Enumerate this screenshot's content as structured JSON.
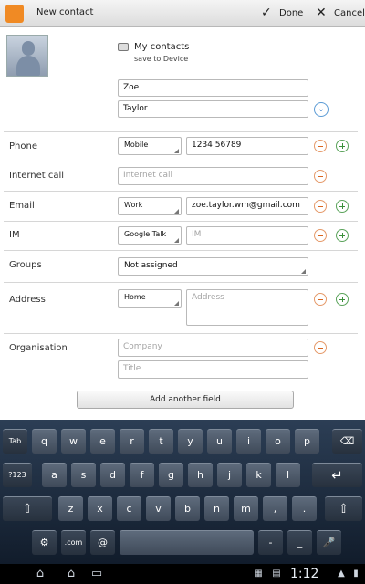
{
  "header": {
    "title": "New contact",
    "done_label": "Done",
    "cancel_label": "Cancel"
  },
  "account": {
    "name": "My contacts",
    "sub": "save to Device"
  },
  "name": {
    "first": "Zoe",
    "last": "Taylor"
  },
  "phone": {
    "label": "Phone",
    "type": "Mobile",
    "value": "1234 56789"
  },
  "internet_call": {
    "label": "Internet call",
    "placeholder": "Internet call"
  },
  "email": {
    "label": "Email",
    "type": "Work",
    "value": "zoe.taylor.wm@gmail.com"
  },
  "im": {
    "label": "IM",
    "type": "Google Talk",
    "placeholder": "IM"
  },
  "groups": {
    "label": "Groups",
    "value": "Not assigned"
  },
  "address": {
    "label": "Address",
    "type": "Home",
    "placeholder": "Address"
  },
  "organisation": {
    "label": "Organisation",
    "company_placeholder": "Company",
    "title_placeholder": "Title"
  },
  "add_field_label": "Add another field",
  "keyboard": {
    "row1": [
      "Tab",
      "q",
      "w",
      "e",
      "r",
      "t",
      "y",
      "u",
      "i",
      "o",
      "p",
      "⌫"
    ],
    "row2": [
      "?123",
      "a",
      "s",
      "d",
      "f",
      "g",
      "h",
      "j",
      "k",
      "l",
      "↵"
    ],
    "row3": [
      "⇧",
      "z",
      "x",
      "c",
      "v",
      "b",
      "n",
      "m",
      ",",
      ".",
      "⇧"
    ],
    "row4": [
      "⚙",
      ".com",
      "@",
      "",
      "-",
      "_",
      "🎤"
    ]
  },
  "navbar": {
    "clock": "1:12"
  }
}
